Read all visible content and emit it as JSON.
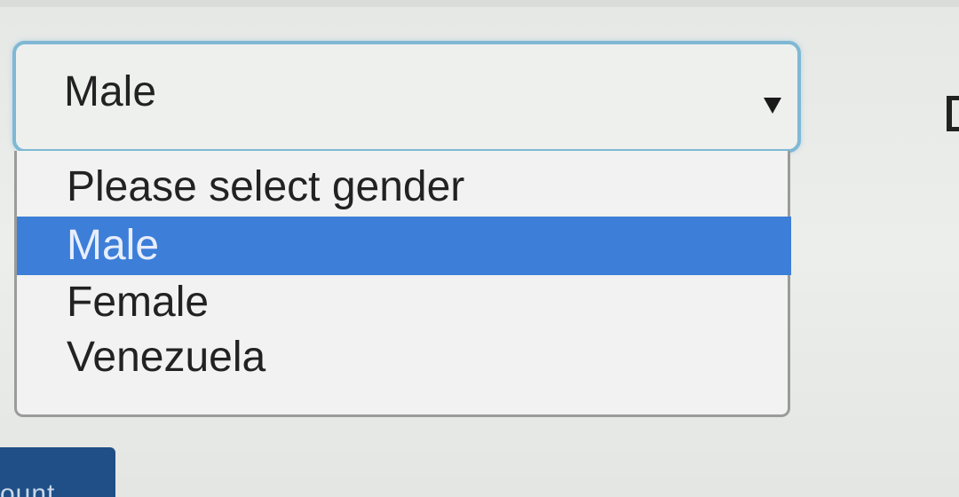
{
  "select": {
    "value": "Male",
    "options": [
      {
        "label": "Please select gender",
        "selected": false
      },
      {
        "label": "Male",
        "selected": true
      },
      {
        "label": "Female",
        "selected": false
      },
      {
        "label": "Venezuela",
        "selected": false
      }
    ]
  },
  "button": {
    "label": "ount"
  },
  "colors": {
    "focus_border": "#7fb8d4",
    "highlight": "#3d7ed8",
    "button": "#1f4f86"
  },
  "icons": {
    "select_arrow": "triangle-down-icon"
  }
}
